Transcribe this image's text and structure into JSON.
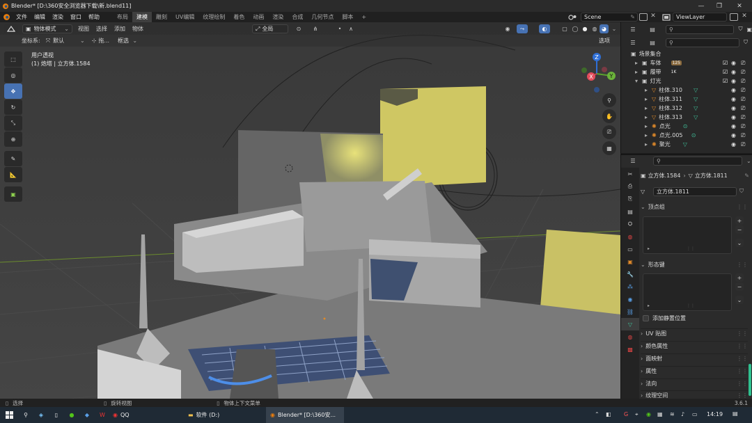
{
  "window": {
    "title": "Blender* [D:\\360安全浏览器下载\\新.blend11]"
  },
  "menu": {
    "items": [
      "文件",
      "编辑",
      "渲染",
      "窗口",
      "帮助"
    ]
  },
  "workspace_tabs": [
    "布局",
    "建模",
    "雕刻",
    "UV编辑",
    "纹理绘制",
    "着色",
    "动画",
    "渲染",
    "合成",
    "几何节点",
    "脚本"
  ],
  "workspace_active": "建模",
  "scene": {
    "name": "Scene"
  },
  "viewlayer": {
    "name": "ViewLayer"
  },
  "viewport": {
    "mode": "物体模式",
    "menus": [
      "视图",
      "选择",
      "添加",
      "物体"
    ],
    "transform_orientation": "全局",
    "coords_label": "坐标系:",
    "coords_value": "默认",
    "drag_label": "拖...",
    "select_mode": "框选",
    "options": "选项",
    "info_line1": "用户透视",
    "info_line2": "(1) 炮塔 | 立方体.1584",
    "gizmo": {
      "z": "Z",
      "y": "Y",
      "x": "X"
    }
  },
  "outliner": {
    "root": "场景集合",
    "items": [
      {
        "label": "车体",
        "extra": "125"
      },
      {
        "label": "履带",
        "extra": "1K"
      },
      {
        "label": "灯光",
        "extra": ""
      },
      {
        "label": "柱体.310",
        "extra": ""
      },
      {
        "label": "柱体.311",
        "extra": ""
      },
      {
        "label": "柱体.312",
        "extra": ""
      },
      {
        "label": "柱体.313",
        "extra": ""
      },
      {
        "label": "点光",
        "extra": ""
      },
      {
        "label": "点光.005",
        "extra": ""
      },
      {
        "label": "聚光",
        "extra": ""
      }
    ]
  },
  "properties": {
    "breadcrumb_obj": "立方体.1584",
    "breadcrumb_mesh": "立方体.1811",
    "mesh_name": "立方体.1811",
    "panel_vertex_groups": "顶点组",
    "panel_shape_keys": "形态键",
    "relative_label": "添加静置位置",
    "collapsed_panels": [
      "UV 贴图",
      "颜色属性",
      "面映射",
      "属性",
      "法向",
      "纹理空间"
    ]
  },
  "statusbar": {
    "select": "选择",
    "rotate": "旋转视图",
    "ctx_menu": "物体上下文菜单",
    "version": "3.6.1"
  },
  "taskbar": {
    "qq": "QQ",
    "explorer": "软件 (D:)",
    "blender": "Blender* [D:\\360安...",
    "time": "14:19"
  },
  "colors": {
    "accent": "#4772b3",
    "viewport_bg": "#3d3d3d",
    "selection": "#334d80"
  }
}
